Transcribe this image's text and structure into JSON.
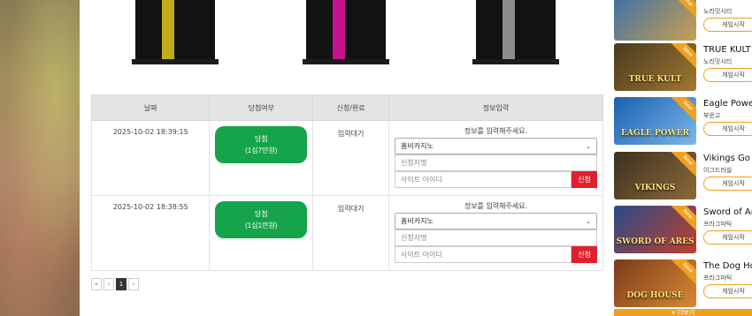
{
  "table": {
    "headers": [
      "날짜",
      "당첨여부",
      "신청/완료",
      "정보입력"
    ],
    "rows": [
      {
        "date": "2025-10-02 18:39:15",
        "win_line1": "당첨",
        "win_line2": "(1십7만원)",
        "status": "입력대기",
        "info_label": "정보를 입력해주세요.",
        "casino_select": "홈비카지노",
        "applicant_placeholder": "신청자명",
        "site_id_placeholder": "사이트 아이디",
        "apply_label": "신청"
      },
      {
        "date": "2025-10-02 18:38:55",
        "win_line1": "당첨",
        "win_line2": "(1십1만원)",
        "status": "입력대기",
        "info_label": "정보를 입력해주세요.",
        "casino_select": "홈비카지노",
        "applicant_placeholder": "신청자명",
        "site_id_placeholder": "사이트 아이디",
        "apply_label": "신청"
      }
    ]
  },
  "pager": {
    "first": "«",
    "prev": "‹",
    "current": "1",
    "next": "›"
  },
  "sidebar": {
    "games": [
      {
        "name": "",
        "provider": "노리밋시티",
        "button": "게임시작",
        "thumb_text": "",
        "new": "New",
        "colors": [
          "#3a6fa8",
          "#c8a050"
        ]
      },
      {
        "name": "TRUE KULT",
        "provider": "노리밋시티",
        "button": "게임시작",
        "thumb_text": "TRUE KULT",
        "new": "New",
        "colors": [
          "#4a3a20",
          "#a07830"
        ]
      },
      {
        "name": "Eagle Power",
        "provider": "부운고",
        "button": "게임시작",
        "thumb_text": "EAGLE POWER",
        "new": "New",
        "colors": [
          "#1b5fb0",
          "#7ab8e8"
        ]
      },
      {
        "name": "Vikings Go T",
        "provider": "이그드라실",
        "button": "게임시작",
        "thumb_text": "VIKINGS",
        "new": "New",
        "colors": [
          "#3d3020",
          "#8a6a38"
        ]
      },
      {
        "name": "Sword of Are",
        "provider": "프라그마틱",
        "button": "게임시작",
        "thumb_text": "SWORD OF ARES",
        "new": "New",
        "colors": [
          "#2a4a8a",
          "#c0402a"
        ]
      },
      {
        "name": "The Dog Hou",
        "provider": "프라그마틱",
        "button": "게임시작",
        "thumb_text": "DOG HOUSE",
        "new": "New",
        "colors": [
          "#7a3a1a",
          "#d88a30"
        ]
      }
    ],
    "more_label": "더보기"
  }
}
